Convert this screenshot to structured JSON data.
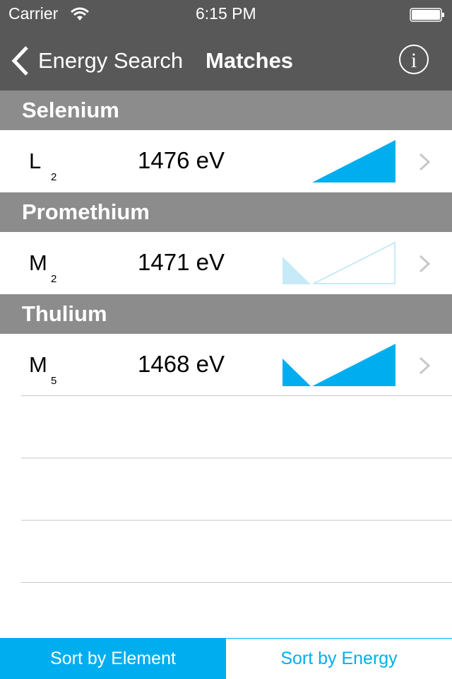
{
  "status_bar": {
    "carrier": "Carrier",
    "time": "6:15 PM",
    "wifi_icon": "wifi-icon",
    "battery_icon": "battery-icon"
  },
  "nav": {
    "back_label": "Energy Search",
    "title": "Matches",
    "info_icon": "info-icon"
  },
  "colors": {
    "accent": "#00aeef",
    "light_accent": "#c7eaf8",
    "header": "#585858",
    "section": "#8c8c8c"
  },
  "sections": [
    {
      "element": "Selenium",
      "shell": "L",
      "subshell": "2",
      "energy": "1476 eV",
      "graphic": "right-triangle-filled"
    },
    {
      "element": "Promethium",
      "shell": "M",
      "subshell": "2",
      "energy": "1471 eV",
      "graphic": "left-triangle-light-plus-outlined-right-triangle"
    },
    {
      "element": "Thulium",
      "shell": "M",
      "subshell": "5",
      "energy": "1468 eV",
      "graphic": "left-triangle-plus-right-triangle-filled"
    }
  ],
  "tabs": [
    {
      "label": "Sort by Element",
      "active": true
    },
    {
      "label": "Sort by Energy",
      "active": false
    }
  ]
}
